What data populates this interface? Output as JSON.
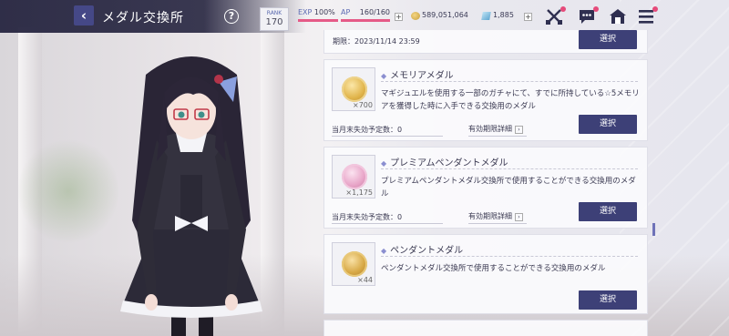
{
  "header": {
    "title": "メダル交換所",
    "back_icon": "chevron-left-icon",
    "help_label": "?"
  },
  "status": {
    "rank_label": "RANK",
    "rank_value": "170",
    "exp_label": "EXP",
    "exp_value": "100%",
    "exp_fraction": 1.0,
    "ap_label": "AP",
    "ap_value": "160/160",
    "ap_fraction": 1.0,
    "coins": "589,051,064",
    "gems": "1,885",
    "plus_label": "+"
  },
  "toolbar": {
    "icons": [
      "battle-icon",
      "chat-icon",
      "home-icon",
      "menu-icon"
    ]
  },
  "list": {
    "first_card": {
      "deadline": "期限：2023/11/14 23:59",
      "select_label": "選択"
    },
    "items": [
      {
        "title": "メモリアメダル",
        "quantity": "×700",
        "description": "マギジュエルを使用する一部のガチャにて、すでに所持している☆5メモリアを獲得した時に入手できる交換用のメダル",
        "expire_label": "当月末失効予定数：0",
        "detail_label": "有効期限詳細",
        "select_label": "選択",
        "medal_color": "gold"
      },
      {
        "title": "プレミアムペンダントメダル",
        "quantity": "×1,175",
        "description": "プレミアムペンダントメダル交換所で使用することができる交換用のメダル",
        "expire_label": "当月末失効予定数：0",
        "detail_label": "有効期限詳細",
        "select_label": "選択",
        "medal_color": "pink"
      },
      {
        "title": "ペンダントメダル",
        "quantity": "×44",
        "description": "ペンダントメダル交換所で使用することができる交換用のメダル",
        "select_label": "選択",
        "medal_color": "bronze"
      }
    ]
  },
  "colors": {
    "accent": "#3d4077",
    "notification": "#e64a7a",
    "bar_fill": "#e55a87"
  }
}
